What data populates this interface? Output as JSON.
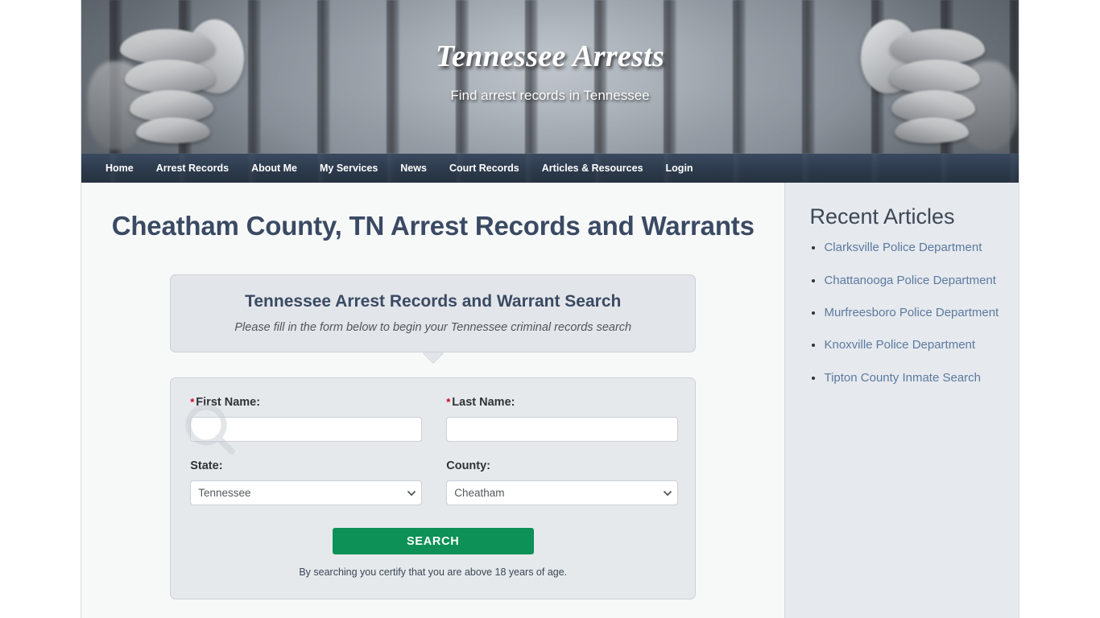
{
  "banner": {
    "title": "Tennessee Arrests",
    "tagline": "Find arrest records in Tennessee",
    "image_alt": "jail-bars-hands-photo"
  },
  "nav": {
    "items": [
      {
        "label": "Home"
      },
      {
        "label": "Arrest Records"
      },
      {
        "label": "About Me"
      },
      {
        "label": "My Services"
      },
      {
        "label": "News"
      },
      {
        "label": "Court Records"
      },
      {
        "label": "Articles & Resources"
      },
      {
        "label": "Login"
      }
    ]
  },
  "main": {
    "page_title": "Cheatham County, TN Arrest Records and Warrants",
    "callout": {
      "title": "Tennessee Arrest Records and Warrant Search",
      "subtitle": "Please fill in the form below to begin your Tennessee criminal records search"
    },
    "form": {
      "first_name": {
        "label": "First Name:",
        "required_marker": "*",
        "value": "",
        "placeholder": ""
      },
      "last_name": {
        "label": "Last Name:",
        "required_marker": "*",
        "value": "",
        "placeholder": ""
      },
      "state": {
        "label": "State:",
        "selected": "Tennessee",
        "options": [
          "Tennessee"
        ]
      },
      "county": {
        "label": "County:",
        "selected": "Cheatham",
        "options": [
          "Cheatham"
        ]
      },
      "submit_label": "SEARCH",
      "disclaimer": "By searching you certify that you are above 18 years of age."
    }
  },
  "sidebar": {
    "title": "Recent Articles",
    "articles": [
      {
        "label": "Clarksville Police Department"
      },
      {
        "label": "Chattanooga Police Department"
      },
      {
        "label": "Murfreesboro Police Department"
      },
      {
        "label": "Knoxville Police Department"
      },
      {
        "label": "Tipton County Inmate Search"
      }
    ]
  },
  "colors": {
    "nav_bg": "#2c3a4c",
    "heading": "#3b4a63",
    "panel_bg": "#e2e6ea",
    "sidebar_bg": "#e6e9ee",
    "link": "#5b7a9e",
    "button_green": "#0d9156",
    "required_red": "#d0021b"
  }
}
